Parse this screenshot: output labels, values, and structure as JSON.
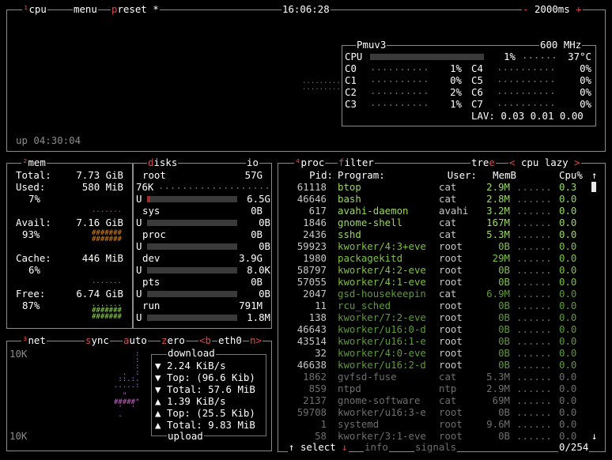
{
  "header": {
    "cpu_num": "¹",
    "cpu": "cpu",
    "menu": "menu",
    "preset_p": "p",
    "preset_rest": "reset",
    "preset_star": "*",
    "time": "16:06:28",
    "minus": "-",
    "interval": "2000ms",
    "plus": "+"
  },
  "cpu": {
    "model": "Pmuv3",
    "freq": "600 MHz",
    "total_label": "CPU",
    "total_pct": "1%",
    "temp": "37°C",
    "total_value": 0.01,
    "cores": [
      {
        "label": "C0",
        "pct": "1%"
      },
      {
        "label": "C1",
        "pct": "0%"
      },
      {
        "label": "C2",
        "pct": "2%"
      },
      {
        "label": "C3",
        "pct": "1%"
      },
      {
        "label": "C4",
        "pct": "0%"
      },
      {
        "label": "C5",
        "pct": "0%"
      },
      {
        "label": "C6",
        "pct": "0%"
      },
      {
        "label": "C7",
        "pct": "0%"
      }
    ],
    "lav_label": "LAV:",
    "lav": "0.03 0.01 0.00",
    "uptime": "up 04:30:04"
  },
  "mem": {
    "num": "²",
    "title": "mem",
    "total_label": "Total:",
    "total": "7.73 GiB",
    "used_label": "Used:",
    "used": "580 MiB",
    "used_pct": "7%",
    "avail_label": "Avail:",
    "avail": "7.16 GiB",
    "avail_pct": "93%",
    "cache_label": "Cache:",
    "cache": "446 MiB",
    "cache_pct": "6%",
    "free_label": "Free:",
    "free": "6.74 GiB",
    "free_pct": "87%"
  },
  "disks": {
    "title_d": "d",
    "title_rest": "isks",
    "io": "io",
    "items": [
      {
        "name": "root",
        "size": "57G",
        "used_label": "76K",
        "bar_label": "U",
        "free": "6.5G",
        "fill": 0.03
      },
      {
        "name": "sys",
        "size": "0B",
        "bar_label": "U",
        "free": "0B",
        "fill": 0
      },
      {
        "name": "proc",
        "size": "0B",
        "bar_label": "U",
        "free": "0B",
        "fill": 0
      },
      {
        "name": "dev",
        "size": "3.9G",
        "bar_label": "U",
        "free": "8.0K",
        "fill": 0
      },
      {
        "name": "pts",
        "size": "0B",
        "bar_label": "U",
        "free": "0B",
        "fill": 0
      },
      {
        "name": "run",
        "size": "791M",
        "bar_label": "U",
        "free": "1.8M",
        "fill": 0
      }
    ]
  },
  "net": {
    "num": "³",
    "title": "net",
    "sync_s": "s",
    "sync_rest": "ync",
    "auto_a": "a",
    "auto_rest": "uto",
    "zero_z": "z",
    "zero_rest": "ero",
    "b_label": "<b",
    "iface": "eth0",
    "n_label": "n>",
    "scale_top": "10K",
    "scale_bottom": "10K",
    "download": "download",
    "dl_rate": "2.24 KiB/s",
    "dl_top": "Top: (96.6 Kib)",
    "dl_total": "Total: 57.6 MiB",
    "ul_rate": "1.39 KiB/s",
    "ul_top": "Top: (25.5 Kib)",
    "ul_total": "Total: 9.83 MiB",
    "upload": "upload",
    "down_arrow": "▼",
    "up_arrow": "▲"
  },
  "proc": {
    "num": "⁴",
    "title": "proc",
    "filter_f": "f",
    "filter_rest": "ilter",
    "tree_rest": "tre",
    "tree_e": "e",
    "lt": "<",
    "mode": "cpu lazy",
    "gt": ">",
    "headers": {
      "pid": "Pid:",
      "program": "Program:",
      "user": "User:",
      "mem": "MemB",
      "cpu": "Cpu%"
    },
    "rows": [
      {
        "pid": "61118",
        "program": "btop",
        "user": "cat",
        "mem": "2.9M",
        "cpu": "0.3",
        "c": "lgreen"
      },
      {
        "pid": "46646",
        "program": "bash",
        "user": "cat",
        "mem": "2.8M",
        "cpu": "0.0",
        "c": "lgreen"
      },
      {
        "pid": "617",
        "program": "avahi-daemon",
        "user": "avahi",
        "mem": "3.2M",
        "cpu": "0.0",
        "c": "lgreen"
      },
      {
        "pid": "1846",
        "program": "gnome-shell",
        "user": "cat",
        "mem": "167M",
        "cpu": "0.0",
        "c": "lgreen"
      },
      {
        "pid": "2436",
        "program": "sshd",
        "user": "cat",
        "mem": "5.3M",
        "cpu": "0.0",
        "c": "lgreen"
      },
      {
        "pid": "59923",
        "program": "kworker/4:3+eve",
        "user": "root",
        "mem": "0B",
        "cpu": "0.0",
        "c": "green"
      },
      {
        "pid": "1980",
        "program": "packagekitd",
        "user": "root",
        "mem": "29M",
        "cpu": "0.0",
        "c": "green"
      },
      {
        "pid": "58797",
        "program": "kworker/4:2-eve",
        "user": "root",
        "mem": "0B",
        "cpu": "0.0",
        "c": "green"
      },
      {
        "pid": "57055",
        "program": "kworker/4:1-eve",
        "user": "root",
        "mem": "0B",
        "cpu": "0.0",
        "c": "green"
      },
      {
        "pid": "2047",
        "program": "gsd-housekeepin",
        "user": "cat",
        "mem": "6.9M",
        "cpu": "0.0",
        "c": "dkgreen"
      },
      {
        "pid": "11",
        "program": "rcu_sched",
        "user": "root",
        "mem": "0B",
        "cpu": "0.0",
        "c": "dkgreen"
      },
      {
        "pid": "138",
        "program": "kworker/7:2-eve",
        "user": "root",
        "mem": "0B",
        "cpu": "0.0",
        "c": "dkgreen"
      },
      {
        "pid": "46643",
        "program": "kworker/u16:0-d",
        "user": "root",
        "mem": "0B",
        "cpu": "0.0",
        "c": "dkgreen"
      },
      {
        "pid": "43514",
        "program": "kworker/u16:1-e",
        "user": "root",
        "mem": "0B",
        "cpu": "0.0",
        "c": "dkgreen"
      },
      {
        "pid": "32",
        "program": "kworker/4:0-eve",
        "user": "root",
        "mem": "0B",
        "cpu": "0.0",
        "c": "dkgreen"
      },
      {
        "pid": "46638",
        "program": "kworker/u16:2-d",
        "user": "root",
        "mem": "0B",
        "cpu": "0.0",
        "c": "dkgreen"
      },
      {
        "pid": "1862",
        "program": "gvfsd-fuse",
        "user": "cat",
        "mem": "5.3M",
        "cpu": "0.0",
        "c": "dim"
      },
      {
        "pid": "859",
        "program": "ntpd",
        "user": "ntp",
        "mem": "2.9M",
        "cpu": "0.0",
        "c": "dim"
      },
      {
        "pid": "2137",
        "program": "gnome-software",
        "user": "cat",
        "mem": "69M",
        "cpu": "0.0",
        "c": "dim"
      },
      {
        "pid": "59708",
        "program": "kworker/u16:3-e",
        "user": "root",
        "mem": "0B",
        "cpu": "0.0",
        "c": "dim"
      },
      {
        "pid": "1",
        "program": "systemd",
        "user": "root",
        "mem": "9.6M",
        "cpu": "0.0",
        "c": "dim"
      },
      {
        "pid": "58",
        "program": "kworker/3:1-eve",
        "user": "root",
        "mem": "0B",
        "cpu": "0.0",
        "c": "dim"
      }
    ],
    "footer": {
      "up_arrow": "↑",
      "select": "select",
      "down_arrow": "↓",
      "info": "info",
      "signals": "signals",
      "count": "0/254"
    },
    "scroll_up": "↑",
    "scroll_down": "↓"
  },
  "colors": {
    "border": "#8a8a8a",
    "title": "#ffffff",
    "hotkey": "#e0484a",
    "green": "#7fc23c",
    "bar_red": "#a12e2e",
    "bar_gray": "#3a3a3a"
  }
}
